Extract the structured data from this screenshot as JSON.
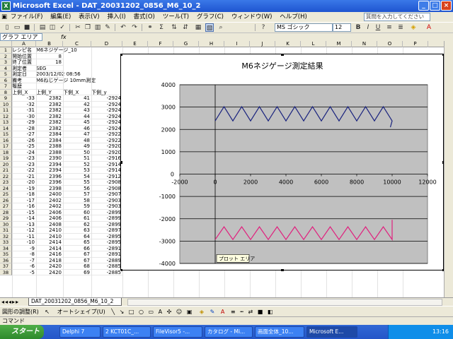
{
  "window": {
    "title": "Microsoft Excel - DAT_20031202_0856_M6_10_2",
    "icon": "excel-icon"
  },
  "menu": {
    "items": [
      "ファイル(F)",
      "編集(E)",
      "表示(V)",
      "挿入(I)",
      "書式(O)",
      "ツール(T)",
      "グラフ(C)",
      "ウィンドウ(W)",
      "ヘルプ(H)"
    ],
    "help_placeholder": "質問を入力してください"
  },
  "toolbar": {
    "font_name": "MS ゴシック",
    "font_size": "12",
    "bold": "B",
    "italic": "I",
    "underline": "U"
  },
  "formula": {
    "name_box": "グラフ エリア",
    "fx": "fx"
  },
  "sheet": {
    "columns": [
      "A",
      "B",
      "C",
      "D",
      "E",
      "F",
      "G",
      "H",
      "I",
      "J",
      "K",
      "L",
      "M",
      "N",
      "O",
      "P"
    ],
    "info": [
      {
        "row": "1",
        "a": "レシピ名",
        "b": "M6ネジゲージ_10"
      },
      {
        "row": "2",
        "a": "開始位置",
        "b": "8"
      },
      {
        "row": "3",
        "a": "終了位置",
        "b": "18"
      },
      {
        "row": "4",
        "a": "測定者",
        "b": "SEG"
      },
      {
        "row": "5",
        "a": "測定日",
        "b": "2003/12/02 08:56"
      },
      {
        "row": "6",
        "a": "備考",
        "b": "M6ねじゲージ 10mm測定"
      },
      {
        "row": "7",
        "a": "履歴",
        "b": ""
      }
    ],
    "header": {
      "row": "8",
      "cols": [
        "上側_X",
        "上側_Y",
        "下側_X",
        "下側_y"
      ]
    },
    "data": [
      [
        "9",
        "-33",
        "2382",
        "41",
        "-2924"
      ],
      [
        "10",
        "-32",
        "2382",
        "42",
        "-2924"
      ],
      [
        "11",
        "-31",
        "2382",
        "43",
        "-2924"
      ],
      [
        "12",
        "-30",
        "2382",
        "44",
        "-2924"
      ],
      [
        "13",
        "-29",
        "2382",
        "45",
        "-2924"
      ],
      [
        "14",
        "-28",
        "2382",
        "46",
        "-2924"
      ],
      [
        "15",
        "-27",
        "2384",
        "47",
        "-2922"
      ],
      [
        "16",
        "-26",
        "2384",
        "48",
        "-2922"
      ],
      [
        "17",
        "-25",
        "2388",
        "49",
        "-2920"
      ],
      [
        "18",
        "-24",
        "2388",
        "50",
        "-2920"
      ],
      [
        "19",
        "-23",
        "2390",
        "51",
        "-2916"
      ],
      [
        "20",
        "-23",
        "2394",
        "52",
        "-2914"
      ],
      [
        "21",
        "-22",
        "2394",
        "53",
        "-2914"
      ],
      [
        "22",
        "-21",
        "2396",
        "54",
        "-2912"
      ],
      [
        "23",
        "-20",
        "2396",
        "55",
        "-2908"
      ],
      [
        "24",
        "-19",
        "2398",
        "56",
        "-2908"
      ],
      [
        "25",
        "-18",
        "2400",
        "57",
        "-2907"
      ],
      [
        "26",
        "-17",
        "2402",
        "58",
        "-2903"
      ],
      [
        "27",
        "-16",
        "2402",
        "59",
        "-2903"
      ],
      [
        "28",
        "-15",
        "2406",
        "60",
        "-2899"
      ],
      [
        "29",
        "-14",
        "2406",
        "61",
        "-2899"
      ],
      [
        "30",
        "-13",
        "2408",
        "62",
        "-2899"
      ],
      [
        "31",
        "-12",
        "2410",
        "63",
        "-2897"
      ],
      [
        "32",
        "-11",
        "2410",
        "64",
        "-2895"
      ],
      [
        "33",
        "-10",
        "2414",
        "65",
        "-2895"
      ],
      [
        "34",
        "-9",
        "2414",
        "66",
        "-2891"
      ],
      [
        "35",
        "-8",
        "2416",
        "67",
        "-2891"
      ],
      [
        "36",
        "-7",
        "2418",
        "67",
        "-2889"
      ],
      [
        "37",
        "-6",
        "2420",
        "68",
        "-2885"
      ],
      [
        "38",
        "-5",
        "2420",
        "69",
        "-2885"
      ]
    ],
    "tab": "DAT_20031202_0856_M6_10_2"
  },
  "chart_data": {
    "type": "line",
    "title": "M6ネジゲージ測定結果",
    "xlim": [
      -2000,
      12000
    ],
    "ylim": [
      -4000,
      4000
    ],
    "xticks": [
      -2000,
      0,
      2000,
      4000,
      6000,
      8000,
      10000,
      12000
    ],
    "yticks": [
      -4000,
      -3000,
      -2000,
      -1000,
      0,
      1000,
      2000,
      3000,
      4000
    ],
    "grid": "horizontal",
    "plot_bg": "#c0c0c0",
    "series": [
      {
        "color": "#1a237e",
        "shape": "triangle",
        "x_start": 0,
        "x_end": 10000,
        "period": 1000,
        "y_min": 2380,
        "y_max": 3020,
        "tail_x": 9900,
        "tail_y": 2100
      },
      {
        "color": "#e0217e",
        "shape": "triangle",
        "x_start": 0,
        "x_end": 10000,
        "period": 1000,
        "y_min": -2930,
        "y_max": -2360,
        "tail_x": 10000,
        "tail_y": -2050
      }
    ],
    "annotation": "プロット エリア"
  },
  "drawbar": {
    "label": "図形の調整(R)",
    "autoshape": "オートシェイプ(U)"
  },
  "status": {
    "text": "コマンド"
  },
  "taskbar": {
    "start": "スタート",
    "tasks": [
      "Delphi 7",
      "2 KCT01C_...",
      "FileVisor5 -...",
      "カタログ - Mi...",
      "画面全体_10...",
      "Microsoft E..."
    ],
    "clock": "13:16"
  },
  "colors": {
    "titlebar": "#1f55d0",
    "taskbar": "#2456c8",
    "start": "#2f8a2c"
  }
}
